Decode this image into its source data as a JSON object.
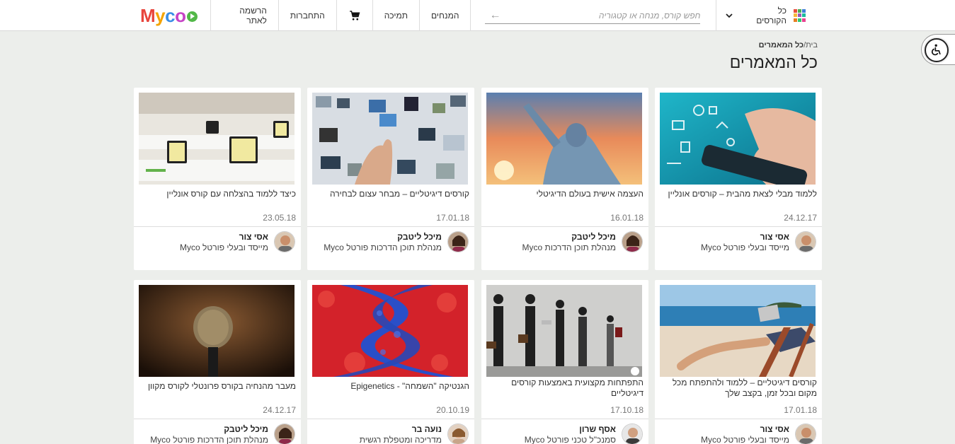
{
  "header": {
    "all_courses": "כל הקורסים",
    "search_placeholder": "חפש קורס, מנחה או קטגוריה",
    "nav": [
      "המנחים",
      "תמיכה",
      "התחברות",
      "הרשמה לאתר"
    ],
    "logo": "Myco",
    "grid_colors": [
      "#e94e3c",
      "#4caf50",
      "#3f7fd8",
      "#f6b93b",
      "#9b59b6",
      "#1abc9c",
      "#e67e22",
      "#2ecc71",
      "#e84393"
    ]
  },
  "breadcrumb": {
    "home": "בית/",
    "current": "כל המאמרים"
  },
  "page_title": "כל המאמרים",
  "cards": [
    {
      "title": "ללמוד מבלי לצאת מהבית – קורסים אונליין",
      "date": "24.12.17",
      "author": "אסי צור",
      "role": "מייסד ובעלי פורטל Myco",
      "image": "hand-with-phone-icons"
    },
    {
      "title": "העצמה אישית בעולם הדיגיטלי",
      "date": "16.01.18",
      "author": "מיכל ליטבק",
      "role": "מנהלת תוכן הדרכות Myco",
      "image": "person-raising-fist-at-sunset"
    },
    {
      "title": "קורסים דיגיטליים – מבחר עצום לבחירה",
      "date": "17.01.18",
      "author": "מיכל ליטבק",
      "role": "מנהלת תוכן הדרכות פורטל Myco",
      "image": "digital-screens-collage"
    },
    {
      "title": "כיצד ללמוד בהצלחה עם קורס אונליין",
      "date": "23.05.18",
      "author": "אסי צור",
      "role": "מייסד ובעלי פורטל Myco",
      "image": "classroom-with-computers"
    },
    {
      "title": "קורסים דיגיטליים – ללמוד ולהתפתח מכל מקום ובכל זמן, בקצב שלך",
      "date": "17.01.18",
      "author": "אסי צור",
      "role": "מייסד ובעלי פורטל Myco",
      "image": "laptop-on-beach"
    },
    {
      "title": "התפתחות מקצועית באמצעות קורסים דיגיטליים",
      "date": "17.10.18",
      "author": "אסף שרון",
      "role": "סמנכ\"ל טכני פורטל Myco",
      "image": "evolution-of-businessmen"
    },
    {
      "title": "הגנטיקה \"השמחה\" - Epigenetics",
      "date": "20.10.19",
      "author": "נועה בר",
      "role": "מדריכה ומטפלת רגשית",
      "image": "dna-helix-red-blue"
    },
    {
      "title": "מעבר מהנחיה בקורס פרונטלי לקורס מקוון",
      "date": "24.12.17",
      "author": "מיכל ליטבק",
      "role": "מנהלת תוכן הדרכות פורטל Myco",
      "image": "microphone"
    }
  ]
}
